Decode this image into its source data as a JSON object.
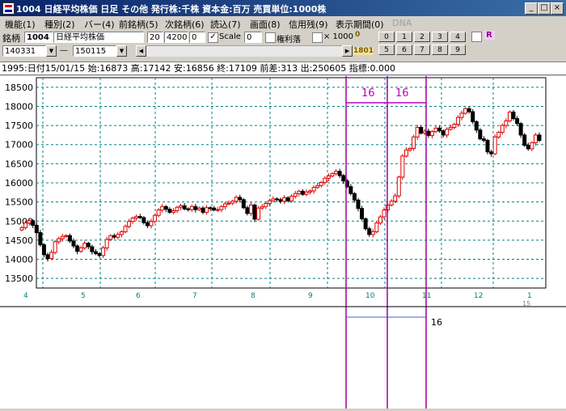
{
  "window": {
    "title": "1004 日経平均株価 日足 その他 発行株:千株 資本金:百万 売買単位:1000株",
    "min": "_",
    "max": "□",
    "close": "×"
  },
  "menu": [
    "機能(1)",
    "種別(2)",
    "バー(4)",
    "前銘柄(5)",
    "次銘柄(6)",
    "読込(7)",
    "画面(8)",
    "信用残(9)",
    "表示期間(0)",
    "DNA"
  ],
  "toolbar": {
    "code_label": "銘柄",
    "code": "1004",
    "name": "日経平均株価",
    "val1": "20",
    "val2": "4200",
    "val3": "0",
    "scale_label": "Scale",
    "scale_value": "0",
    "rights_label": "権利落",
    "x1000_label": "× 1000",
    "small_top": "0",
    "small_bottom": "1801",
    "num_buttons_top": [
      "0",
      "1",
      "2",
      "3",
      "4"
    ],
    "num_buttons_bottom": [
      "5",
      "6",
      "7",
      "8",
      "9"
    ],
    "r_label": "R",
    "date_from": "140331",
    "dash": "—",
    "date_to": "150115"
  },
  "info_line": "1995:日付15/01/15 始:16873 高:17142 安:16856 終:17109 前差:313 出:250605 指標:0.000",
  "colors": {
    "up": "#e00000",
    "down": "#000000",
    "grid": "#008080",
    "marker": "#a000a0",
    "range": "#c000c0",
    "hline": "#4060e0"
  },
  "chart_data": {
    "type": "candlestick",
    "ylim": [
      13250,
      18750
    ],
    "yticks": [
      "18500",
      "18000",
      "17500",
      "17000",
      "16500",
      "16000",
      "15500",
      "15000",
      "14500",
      "14000",
      "13500"
    ],
    "xticks": [
      "4",
      "5",
      "6",
      "7",
      "8",
      "9",
      "10",
      "11",
      "12",
      "1"
    ],
    "xtick_sub": "15",
    "range_labels": [
      "16",
      "16"
    ],
    "lower_label": "16",
    "closes": [
      14830,
      14950,
      15010,
      14890,
      14700,
      14380,
      14120,
      14020,
      14180,
      14460,
      14540,
      14600,
      14620,
      14480,
      14350,
      14210,
      14300,
      14420,
      14330,
      14200,
      14150,
      14100,
      14300,
      14520,
      14620,
      14580,
      14650,
      14720,
      14860,
      14990,
      15080,
      15120,
      15090,
      14960,
      14880,
      14990,
      15150,
      15290,
      15380,
      15310,
      15230,
      15270,
      15360,
      15400,
      15320,
      15300,
      15380,
      15300,
      15340,
      15230,
      15350,
      15340,
      15290,
      15300,
      15380,
      15450,
      15470,
      15520,
      15620,
      15560,
      15350,
      15200,
      15420,
      15050,
      15340,
      15380,
      15460,
      15530,
      15580,
      15560,
      15520,
      15610,
      15530,
      15650,
      15720,
      15780,
      15700,
      15760,
      15790,
      15880,
      15930,
      16010,
      16120,
      16180,
      16240,
      16300,
      16190,
      16050,
      15900,
      15720,
      15550,
      15330,
      15060,
      14800,
      14650,
      14720,
      14950,
      15110,
      15290,
      15420,
      15520,
      15660,
      16150,
      16700,
      16860,
      16900,
      17200,
      17450,
      17300,
      17350,
      17240,
      17340,
      17430,
      17360,
      17250,
      17400,
      17450,
      17530,
      17710,
      17820,
      17940,
      17860,
      17600,
      17380,
      17150,
      17110,
      16810,
      16760,
      17200,
      17320,
      17500,
      17620,
      17850,
      17680,
      17550,
      17250,
      16980,
      16890,
      17050,
      17250,
      17109
    ]
  }
}
